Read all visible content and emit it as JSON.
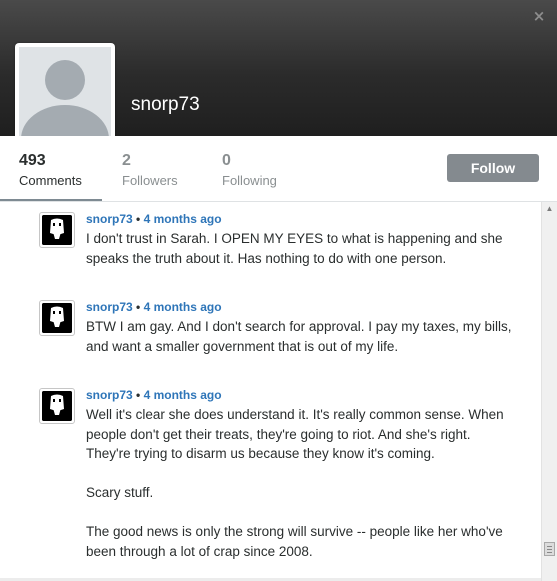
{
  "profile": {
    "username": "snorp73",
    "close_icon": "×"
  },
  "stats": [
    {
      "number": "493",
      "label": "Comments",
      "active": true
    },
    {
      "number": "2",
      "label": "Followers",
      "active": false
    },
    {
      "number": "0",
      "label": "Following",
      "active": false
    }
  ],
  "follow_button": {
    "label": "Follow"
  },
  "comments": [
    {
      "author": "snorp73",
      "separator": "•",
      "time": "4 months ago",
      "text": "I don't trust in Sarah. I OPEN MY EYES to what is happening and she speaks the truth about it. Has nothing to do with one person."
    },
    {
      "author": "snorp73",
      "separator": "•",
      "time": "4 months ago",
      "text": "BTW I am gay. And I don't search for approval. I pay my taxes, my bills, and want a smaller government that is out of my life."
    },
    {
      "author": "snorp73",
      "separator": "•",
      "time": "4 months ago",
      "text": "Well it's clear she does understand it. It's really common sense. When people don't get their treats, they're going to riot. And she's right. They're trying to disarm us because they know it's coming.\n\nScary stuff.\n\nThe good news is only the strong will survive -- people like her who've been through a lot of crap since 2008."
    }
  ],
  "colors": {
    "accent_link": "#2e75b8",
    "follow_button_bg": "#848a8f",
    "header_dark": "#2b2b2b",
    "avatar_placeholder": "#a4abb1"
  },
  "icons": {
    "close": "close-icon",
    "default_avatar": "default-avatar-icon",
    "comment_avatar": "anonymous-mask-icon",
    "scroll_up": "scroll-up-arrow-icon"
  }
}
